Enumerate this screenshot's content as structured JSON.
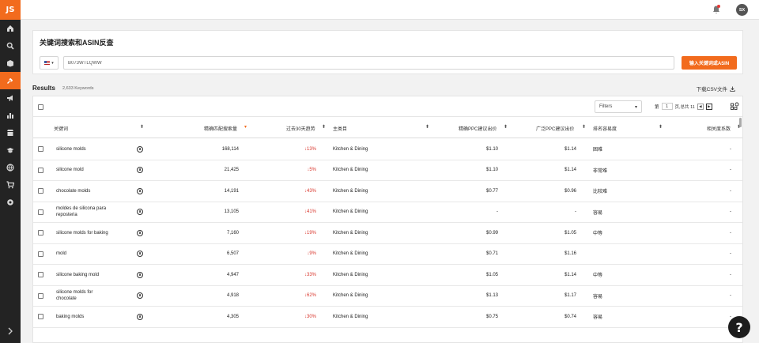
{
  "app": {
    "logo_text": "JS"
  },
  "sidebar": {
    "items": [
      {
        "icon": "home-icon"
      },
      {
        "icon": "search-icon"
      },
      {
        "icon": "box-icon"
      },
      {
        "icon": "tools-icon",
        "active": true
      },
      {
        "icon": "megaphone-icon"
      },
      {
        "icon": "bar-chart-icon"
      },
      {
        "icon": "store-icon"
      },
      {
        "icon": "graduation-cap-icon"
      },
      {
        "icon": "globe-icon"
      },
      {
        "icon": "cart-icon"
      },
      {
        "icon": "settings-icon"
      }
    ]
  },
  "topbar": {
    "avatar_initials": "SX"
  },
  "search": {
    "title": "关键词搜索和ASIN反查",
    "asin_value": "B073WTLQWW",
    "submit_label": "输入关键词或ASIN"
  },
  "results": {
    "label": "Results",
    "count": "2,633 Keywords",
    "download_label": "下载CSV文件",
    "filters_label": "Filters",
    "pager": {
      "prefix": "第",
      "page": "1",
      "suffix": "页,总共 11"
    },
    "columns": [
      "关键词",
      "精确匹配搜索量",
      "过去30天趋势",
      "主类目",
      "精确PPC建议出价",
      "广泛PPC建议出价",
      "排名容易度",
      "相关度系数"
    ],
    "rows": [
      {
        "keyword": "silicone molds",
        "volume": "168,114",
        "trend": "↓13%",
        "category": "Kitchen & Dining",
        "exact_ppc": "$1.10",
        "broad_ppc": "$1.14",
        "ease": "困难",
        "relevance": "-"
      },
      {
        "keyword": "silicone mold",
        "volume": "21,425",
        "trend": "↓5%",
        "category": "Kitchen & Dining",
        "exact_ppc": "$1.10",
        "broad_ppc": "$1.14",
        "ease": "非常难",
        "relevance": "-"
      },
      {
        "keyword": "chocolate molds",
        "volume": "14,191",
        "trend": "↓43%",
        "category": "Kitchen & Dining",
        "exact_ppc": "$0.77",
        "broad_ppc": "$0.96",
        "ease": "比较难",
        "relevance": "-"
      },
      {
        "keyword": "moldes de silicona para reposteria",
        "volume": "13,105",
        "trend": "↓41%",
        "category": "Kitchen & Dining",
        "exact_ppc": "-",
        "broad_ppc": "-",
        "ease": "容易",
        "relevance": "-"
      },
      {
        "keyword": "silicone molds for baking",
        "volume": "7,160",
        "trend": "↓19%",
        "category": "Kitchen & Dining",
        "exact_ppc": "$0.99",
        "broad_ppc": "$1.05",
        "ease": "中等",
        "relevance": "-"
      },
      {
        "keyword": "mold",
        "volume": "6,507",
        "trend": "↓9%",
        "category": "Kitchen & Dining",
        "exact_ppc": "$0.71",
        "broad_ppc": "$1.16",
        "ease": "",
        "relevance": "-"
      },
      {
        "keyword": "silicone baking mold",
        "volume": "4,947",
        "trend": "↓33%",
        "category": "Kitchen & Dining",
        "exact_ppc": "$1.05",
        "broad_ppc": "$1.14",
        "ease": "中等",
        "relevance": "-"
      },
      {
        "keyword": "silicone molds for chocolate",
        "volume": "4,918",
        "trend": "↓62%",
        "category": "Kitchen & Dining",
        "exact_ppc": "$1.13",
        "broad_ppc": "$1.17",
        "ease": "容易",
        "relevance": "-"
      },
      {
        "keyword": "baking molds",
        "volume": "4,305",
        "trend": "↓30%",
        "category": "Kitchen & Dining",
        "exact_ppc": "$0.75",
        "broad_ppc": "$0.74",
        "ease": "容易",
        "relevance": "-"
      }
    ]
  },
  "help": {
    "label": "?"
  }
}
